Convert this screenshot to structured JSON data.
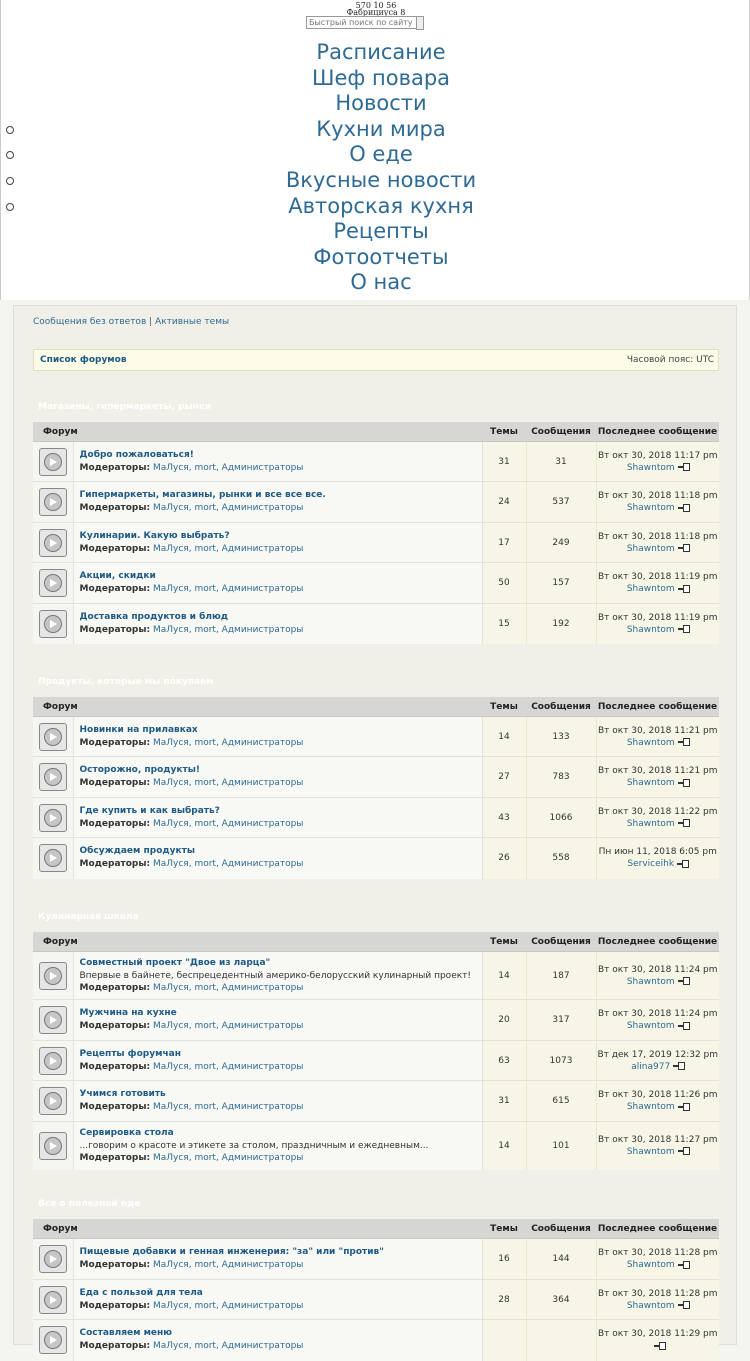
{
  "header": {
    "line1": "570 10 56",
    "line2": "Фабрициуса 8",
    "search_placeholder": "Быстрый поиск по сайту"
  },
  "nav": [
    "Расписание",
    "Шеф повара",
    "Новости",
    "Кухни мира",
    "О еде",
    "Вкусные новости",
    "Авторская кухня",
    "Рецепты",
    "Фотоотчеты",
    "О нас"
  ],
  "links": {
    "unanswered": "Сообщения без ответов",
    "separator": "|",
    "active": "Активные темы"
  },
  "breadcrumb": {
    "forum_list": "Список форумов",
    "timezone": "Часовой пояс: UTC"
  },
  "columns": {
    "forum": "Форум",
    "topics": "Темы",
    "posts": "Сообщения",
    "last": "Последнее сообщение"
  },
  "moderators_label": "Модераторы:",
  "moderators": "МаЛуся, mort, Администраторы",
  "categories": [
    {
      "title": "Магазины, гипермаркеты, рынки",
      "forums": [
        {
          "name": "Добро пожаловаться!",
          "desc": "",
          "topics": "31",
          "posts": "31",
          "last_date": "Вт окт 30, 2018 11:17 pm",
          "last_user": "Shawntom"
        },
        {
          "name": "Гипермаркеты, магазины, рынки и все все все.",
          "desc": "",
          "topics": "24",
          "posts": "537",
          "last_date": "Вт окт 30, 2018 11:18 pm",
          "last_user": "Shawntom"
        },
        {
          "name": "Кулинарии. Какую выбрать?",
          "desc": "",
          "topics": "17",
          "posts": "249",
          "last_date": "Вт окт 30, 2018 11:18 pm",
          "last_user": "Shawntom"
        },
        {
          "name": "Акции, скидки",
          "desc": "",
          "topics": "50",
          "posts": "157",
          "last_date": "Вт окт 30, 2018 11:19 pm",
          "last_user": "Shawntom"
        },
        {
          "name": "Доставка продуктов и блюд",
          "desc": "",
          "topics": "15",
          "posts": "192",
          "last_date": "Вт окт 30, 2018 11:19 pm",
          "last_user": "Shawntom"
        }
      ]
    },
    {
      "title": "Продукты, которые мы покупаем",
      "forums": [
        {
          "name": "Новинки на прилавках",
          "desc": "",
          "topics": "14",
          "posts": "133",
          "last_date": "Вт окт 30, 2018 11:21 pm",
          "last_user": "Shawntom"
        },
        {
          "name": "Осторожно, продукты!",
          "desc": "",
          "topics": "27",
          "posts": "783",
          "last_date": "Вт окт 30, 2018 11:21 pm",
          "last_user": "Shawntom"
        },
        {
          "name": "Где купить и как выбрать?",
          "desc": "",
          "topics": "43",
          "posts": "1066",
          "last_date": "Вт окт 30, 2018 11:22 pm",
          "last_user": "Shawntom"
        },
        {
          "name": "Обсуждаем продукты",
          "desc": "",
          "topics": "26",
          "posts": "558",
          "last_date": "Пн июн 11, 2018 6:05 pm",
          "last_user": "Serviceihk"
        }
      ]
    },
    {
      "title": "Кулинарная школа",
      "forums": [
        {
          "name": "Совместный проект \"Двое из ларца\"",
          "desc": "Впервые в байнете, беспрецедентный америко-белорусский кулинарный проект!",
          "topics": "14",
          "posts": "187",
          "last_date": "Вт окт 30, 2018 11:24 pm",
          "last_user": "Shawntom"
        },
        {
          "name": "Мужчина на кухне",
          "desc": "",
          "topics": "20",
          "posts": "317",
          "last_date": "Вт окт 30, 2018 11:24 pm",
          "last_user": "Shawntom"
        },
        {
          "name": "Рецепты форумчан",
          "desc": "",
          "topics": "63",
          "posts": "1073",
          "last_date": "Вт дек 17, 2019 12:32 pm",
          "last_user": "alina977"
        },
        {
          "name": "Учимся готовить",
          "desc": "",
          "topics": "31",
          "posts": "615",
          "last_date": "Вт окт 30, 2018 11:26 pm",
          "last_user": "Shawntom"
        },
        {
          "name": "Сервировка стола",
          "desc": "...говорим о красоте и этикете за столом, праздничным и ежедневным...",
          "topics": "14",
          "posts": "101",
          "last_date": "Вт окт 30, 2018 11:27 pm",
          "last_user": "Shawntom"
        }
      ]
    },
    {
      "title": "Все о полезной еде",
      "forums": [
        {
          "name": "Пищевые добавки и генная инженерия: \"за\" или \"против\"",
          "desc": "",
          "topics": "16",
          "posts": "144",
          "last_date": "Вт окт 30, 2018 11:28 pm",
          "last_user": "Shawntom"
        },
        {
          "name": "Еда с пользой для тела",
          "desc": "",
          "topics": "28",
          "posts": "364",
          "last_date": "Вт окт 30, 2018 11:28 pm",
          "last_user": "Shawntom"
        },
        {
          "name": "Составляем меню",
          "desc": "",
          "topics": "",
          "posts": "",
          "last_date": "Вт окт 30, 2018 11:29 pm",
          "last_user": ""
        }
      ]
    }
  ]
}
